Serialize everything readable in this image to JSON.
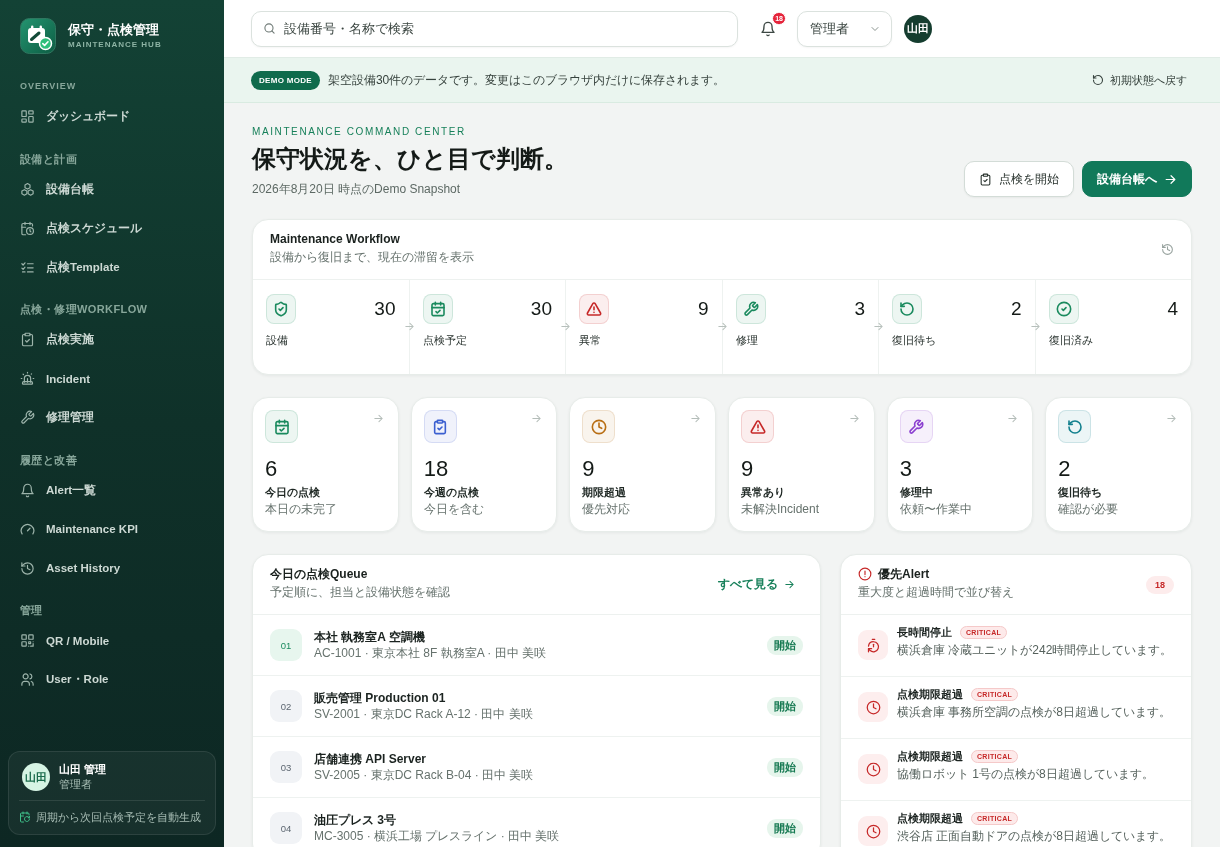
{
  "sidebar": {
    "brand": {
      "title": "保守・点検管理",
      "subtitle": "MAINTENANCE HUB"
    },
    "sections": [
      {
        "title": "OVERVIEW",
        "items": [
          {
            "label": "ダッシュボード",
            "kind": "grid",
            "selected": false
          }
        ]
      },
      {
        "title": "設備と計画",
        "items": [
          {
            "label": "設備台帳",
            "kind": "cubes",
            "selected": false
          },
          {
            "label": "点検スケジュール",
            "kind": "schedule",
            "selected": false
          },
          {
            "label": "点検Template",
            "kind": "checklist",
            "selected": false
          }
        ]
      },
      {
        "title": "点検・修理WORKFLOW",
        "items": [
          {
            "label": "点検実施",
            "kind": "clipboard",
            "selected": false
          },
          {
            "label": "Incident",
            "kind": "siren",
            "selected": false
          },
          {
            "label": "修理管理",
            "kind": "wrench",
            "selected": false
          }
        ]
      },
      {
        "title": "履歴と改善",
        "items": [
          {
            "label": "Alert一覧",
            "kind": "bell",
            "selected": false
          },
          {
            "label": "Maintenance KPI",
            "kind": "gauge",
            "selected": false
          },
          {
            "label": "Asset History",
            "kind": "history",
            "selected": false
          }
        ]
      },
      {
        "title": "管理",
        "items": [
          {
            "label": "QR / Mobile",
            "kind": "qr",
            "selected": false
          },
          {
            "label": "User・Role",
            "kind": "users",
            "selected": false
          }
        ]
      }
    ],
    "user": {
      "avatar": "山田",
      "name": "山田 管理",
      "role": "管理者",
      "note": "周期から次回点検予定を自動生成"
    }
  },
  "header": {
    "search": {
      "placeholder": "設備番号・名称で検索"
    },
    "notifications": {
      "count": "18"
    },
    "role_select": {
      "value": "管理者"
    },
    "avatar": "山田"
  },
  "demo_banner": {
    "badge": "DEMO MODE",
    "message": "架空設備30件のデータです。変更はこのブラウザ内だけに保存されます。",
    "reset": "初期状態へ戻す"
  },
  "hero": {
    "eyebrow": "MAINTENANCE COMMAND CENTER",
    "title": "保守状況を、ひと目で判断。",
    "subtitle": "2026年8月20日 時点のDemo Snapshot",
    "buttons": [
      {
        "label": "点検を開始",
        "kind": "secondary"
      },
      {
        "label": "設備台帳へ",
        "kind": "primary"
      }
    ]
  },
  "workflow": {
    "title": "Maintenance Workflow",
    "subtitle": "設備から復旧まで、現在の滞留を表示",
    "stages": [
      {
        "label": "設備",
        "count": "30",
        "kind": "shield",
        "color": "#1a8a5e"
      },
      {
        "label": "点検予定",
        "count": "30",
        "kind": "calendar",
        "color": "#1a8a5e"
      },
      {
        "label": "異常",
        "count": "9",
        "kind": "alert",
        "color": "#c62828"
      },
      {
        "label": "修理",
        "count": "3",
        "kind": "wrench",
        "color": "#1a8a5e"
      },
      {
        "label": "復旧待ち",
        "count": "2",
        "kind": "rotate",
        "color": "#1a8a5e"
      },
      {
        "label": "復旧済み",
        "count": "4",
        "kind": "check",
        "color": "#1a8a5e"
      }
    ]
  },
  "kpis": [
    {
      "value": "6",
      "label": "今日の点検",
      "note": "本日の未完了",
      "kind": "calendar",
      "color": "#1a8a5e"
    },
    {
      "value": "18",
      "label": "今週の点検",
      "note": "今日を含む",
      "kind": "clipboard",
      "color": "#3a5fd0"
    },
    {
      "value": "9",
      "label": "期限超過",
      "note": "優先対応",
      "kind": "clock",
      "color": "#b86e14"
    },
    {
      "value": "9",
      "label": "異常あり",
      "note": "未解決Incident",
      "kind": "alert",
      "color": "#c62828"
    },
    {
      "value": "3",
      "label": "修理中",
      "note": "依頼〜作業中",
      "kind": "wrench",
      "color": "#8b3fd0"
    },
    {
      "value": "2",
      "label": "復旧待ち",
      "note": "確認が必要",
      "kind": "rotate",
      "color": "#13808e"
    }
  ],
  "queue": {
    "title": "今日の点検Queue",
    "subtitle": "予定順に、担当と設備状態を確認",
    "link": "すべて見る",
    "rows": [
      {
        "number": "01",
        "name": "本社 執務室A 空調機",
        "details": "AC-1001 · 東京本社 8F 執務室A · 田中 美咲",
        "action": "開始",
        "active": true
      },
      {
        "number": "02",
        "name": "販売管理 Production 01",
        "details": "SV-2001 · 東京DC Rack A-12 · 田中 美咲",
        "action": "開始",
        "active": false
      },
      {
        "number": "03",
        "name": "店舗連携 API Server",
        "details": "SV-2005 · 東京DC Rack B-04 · 田中 美咲",
        "action": "開始",
        "active": false
      },
      {
        "number": "04",
        "name": "油圧プレス 3号",
        "details": "MC-3005 · 横浜工場 プレスライン · 田中 美咲",
        "action": "開始",
        "active": false
      }
    ]
  },
  "alerts": {
    "title": "優先Alert",
    "subtitle": "重大度と超過時間で並び替え",
    "count": "18",
    "items": [
      {
        "title": "長時間停止",
        "severity": "CRITICAL",
        "message": "横浜倉庫 冷蔵ユニットが242時間停止しています。",
        "kind": "timer"
      },
      {
        "title": "点検期限超過",
        "severity": "CRITICAL",
        "message": "横浜倉庫 事務所空調の点検が8日超過しています。",
        "kind": "clock"
      },
      {
        "title": "点検期限超過",
        "severity": "CRITICAL",
        "message": "協働ロボット 1号の点検が8日超過しています。",
        "kind": "clock"
      },
      {
        "title": "点検期限超過",
        "severity": "CRITICAL",
        "message": "渋谷店 正面自動ドアの点検が8日超過しています。",
        "kind": "clock"
      }
    ]
  }
}
